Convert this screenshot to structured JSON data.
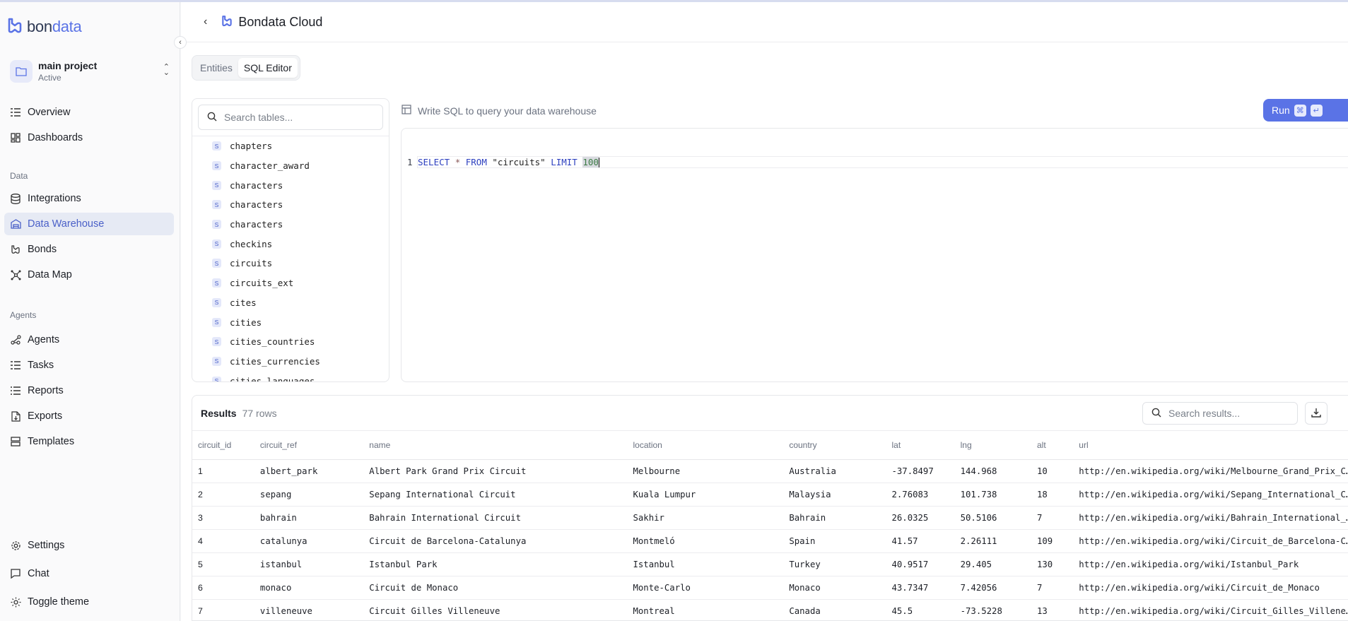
{
  "brand": {
    "logo_prefix": "bon",
    "logo_suffix": "data",
    "accent": "#5a73e6"
  },
  "project": {
    "name": "main project",
    "status": "Active"
  },
  "sidebar": {
    "top_items": [
      {
        "label": "Overview",
        "icon": "list-icon"
      },
      {
        "label": "Dashboards",
        "icon": "dashboard-icon"
      }
    ],
    "data_section_label": "Data",
    "data_items": [
      {
        "label": "Integrations",
        "icon": "database-icon"
      },
      {
        "label": "Data Warehouse",
        "icon": "warehouse-icon",
        "active": true
      },
      {
        "label": "Bonds",
        "icon": "bond-icon"
      },
      {
        "label": "Data Map",
        "icon": "network-icon"
      }
    ],
    "agents_section_label": "Agents",
    "agent_items": [
      {
        "label": "Agents",
        "icon": "agents-icon"
      },
      {
        "label": "Tasks",
        "icon": "tasks-icon"
      },
      {
        "label": "Reports",
        "icon": "reports-icon"
      },
      {
        "label": "Exports",
        "icon": "export-icon"
      },
      {
        "label": "Templates",
        "icon": "templates-icon"
      }
    ],
    "bottom_items": [
      {
        "label": "Settings",
        "icon": "gear-icon"
      },
      {
        "label": "Chat",
        "icon": "chat-icon"
      },
      {
        "label": "Toggle theme",
        "icon": "sun-icon"
      }
    ]
  },
  "header": {
    "title": "Bondata Cloud"
  },
  "tabs": [
    {
      "label": "Entities",
      "active": false
    },
    {
      "label": "SQL Editor",
      "active": true
    }
  ],
  "tables_panel": {
    "search_placeholder": "Search tables...",
    "badge": "S",
    "items": [
      "chapters",
      "character_award",
      "characters",
      "characters",
      "characters",
      "checkins",
      "circuits",
      "circuits_ext",
      "cites",
      "cities",
      "cities_countries",
      "cities_currencies",
      "cities_languages"
    ]
  },
  "editor": {
    "hint": "Write SQL to query your data warehouse",
    "run_label": "Run",
    "run_kbd_1": "⌘",
    "run_kbd_2": "↵",
    "line_number": "1",
    "code": {
      "kw1": "SELECT",
      "op": "*",
      "kw2": "FROM",
      "str": "\"circuits\"",
      "kw3": "LIMIT",
      "num": "100"
    }
  },
  "results": {
    "title": "Results",
    "count": "77 rows",
    "search_placeholder": "Search results...",
    "columns": [
      "circuit_id",
      "circuit_ref",
      "name",
      "location",
      "country",
      "lat",
      "lng",
      "alt",
      "url"
    ],
    "rows": [
      [
        "1",
        "albert_park",
        "Albert Park Grand Prix Circuit",
        "Melbourne",
        "Australia",
        "-37.8497",
        "144.968",
        "10",
        "http://en.wikipedia.org/wiki/Melbourne_Grand_Prix_Circuit"
      ],
      [
        "2",
        "sepang",
        "Sepang International Circuit",
        "Kuala Lumpur",
        "Malaysia",
        "2.76083",
        "101.738",
        "18",
        "http://en.wikipedia.org/wiki/Sepang_International_Circuit"
      ],
      [
        "3",
        "bahrain",
        "Bahrain International Circuit",
        "Sakhir",
        "Bahrain",
        "26.0325",
        "50.5106",
        "7",
        "http://en.wikipedia.org/wiki/Bahrain_International_Circuit"
      ],
      [
        "4",
        "catalunya",
        "Circuit de Barcelona-Catalunya",
        "Montmeló",
        "Spain",
        "41.57",
        "2.26111",
        "109",
        "http://en.wikipedia.org/wiki/Circuit_de_Barcelona-Catalunya"
      ],
      [
        "5",
        "istanbul",
        "Istanbul Park",
        "Istanbul",
        "Turkey",
        "40.9517",
        "29.405",
        "130",
        "http://en.wikipedia.org/wiki/Istanbul_Park"
      ],
      [
        "6",
        "monaco",
        "Circuit de Monaco",
        "Monte-Carlo",
        "Monaco",
        "43.7347",
        "7.42056",
        "7",
        "http://en.wikipedia.org/wiki/Circuit_de_Monaco"
      ],
      [
        "7",
        "villeneuve",
        "Circuit Gilles Villeneuve",
        "Montreal",
        "Canada",
        "45.5",
        "-73.5228",
        "13",
        "http://en.wikipedia.org/wiki/Circuit_Gilles_Villeneuve"
      ]
    ]
  }
}
